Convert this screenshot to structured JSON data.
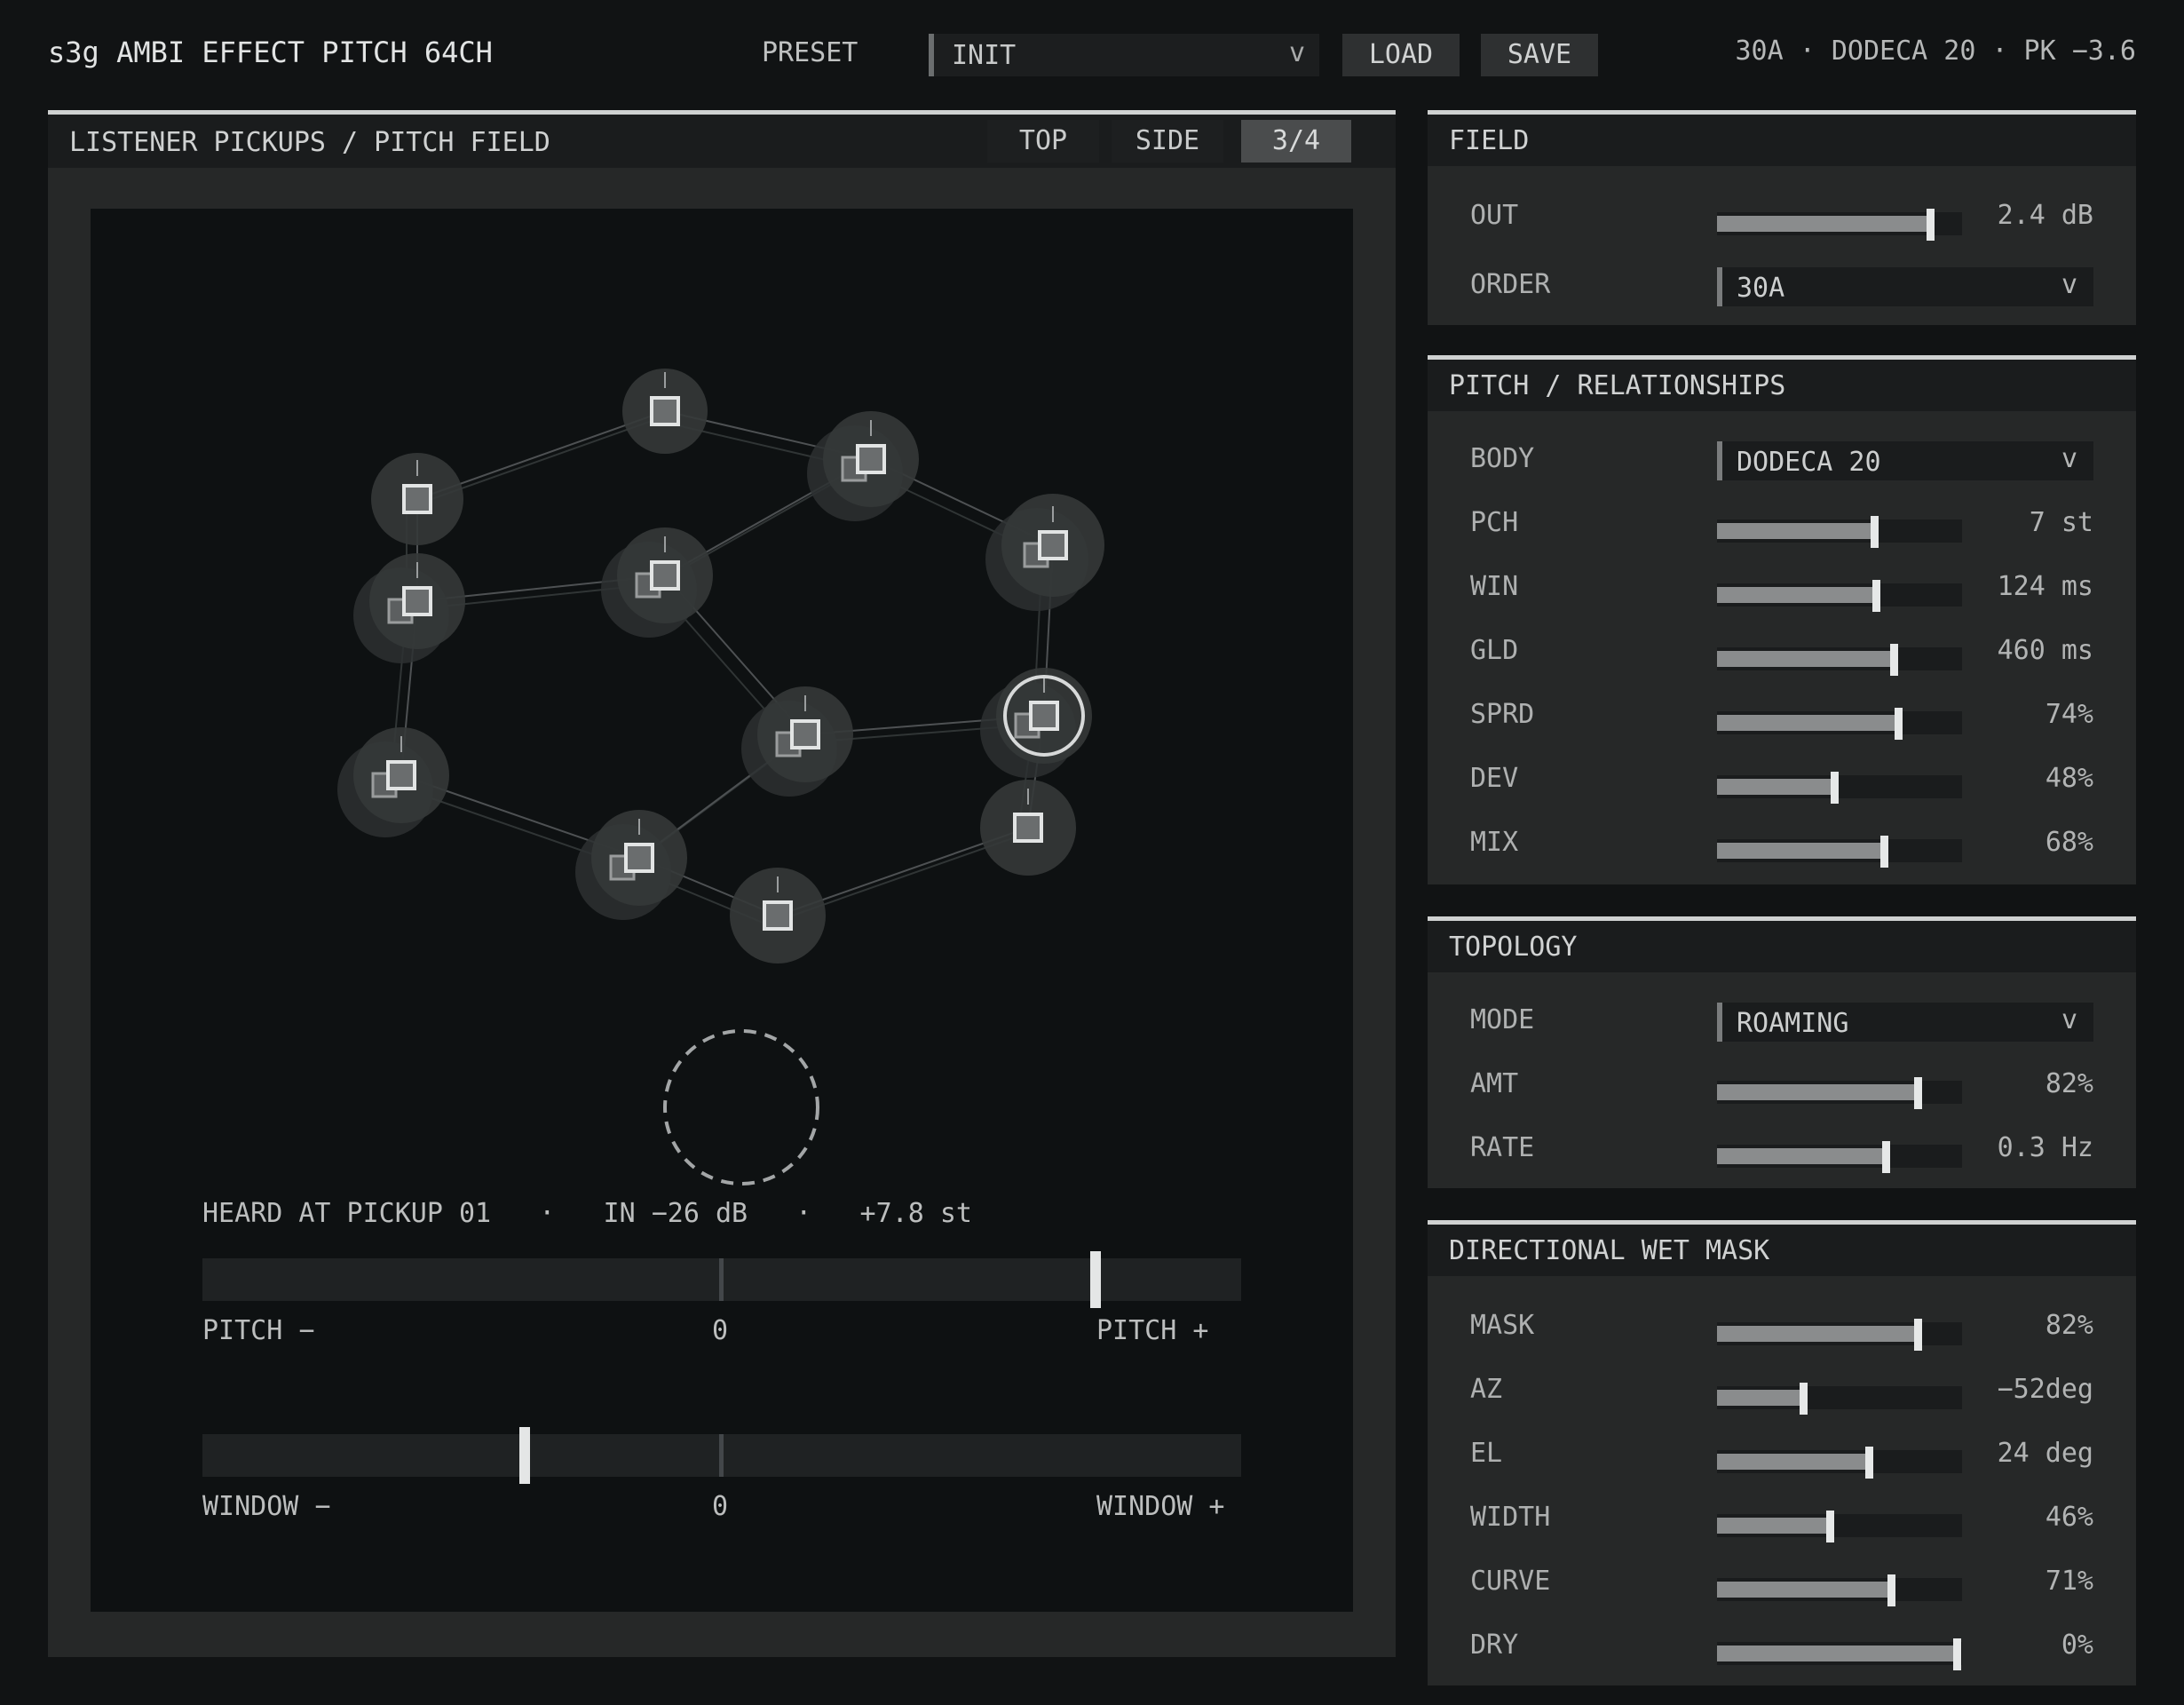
{
  "header": {
    "app_title": "s3g AMBI EFFECT PITCH 64CH",
    "preset_label": "PRESET",
    "preset_value": "INIT",
    "load_label": "LOAD",
    "save_label": "SAVE",
    "status_readout": "30A · DODECA 20 · PK −3.6",
    "chevron": "v"
  },
  "field_panel": {
    "title": "LISTENER PICKUPS / PITCH FIELD",
    "tabs": [
      {
        "label": "TOP",
        "active": false
      },
      {
        "label": "SIDE",
        "active": false
      },
      {
        "label": "3/4",
        "active": true
      }
    ],
    "heard_readout": "HEARD AT PICKUP 01   ·   IN −26 dB   ·   +7.8 st",
    "pitch_bar": {
      "minus_label": "PITCH −",
      "center_label": "0",
      "plus_label": "PITCH +",
      "value_fraction": 0.86
    },
    "window_bar": {
      "minus_label": "WINDOW −",
      "center_label": "0",
      "plus_label": "WINDOW +",
      "value_fraction": 0.31
    }
  },
  "panels": {
    "field": {
      "title": "FIELD",
      "rows": [
        {
          "label": "OUT",
          "kind": "slider",
          "fraction": 0.87,
          "value": "2.4 dB"
        },
        {
          "label": "ORDER",
          "kind": "select",
          "value": "30A"
        }
      ]
    },
    "pitch": {
      "title": "PITCH / RELATIONSHIPS",
      "rows": [
        {
          "label": "BODY",
          "kind": "select",
          "value": "DODECA 20"
        },
        {
          "label": "PCH",
          "kind": "slider",
          "fraction": 0.64,
          "value": "7 st"
        },
        {
          "label": "WIN",
          "kind": "slider",
          "fraction": 0.65,
          "value": "124 ms"
        },
        {
          "label": "GLD",
          "kind": "slider",
          "fraction": 0.72,
          "value": "460 ms"
        },
        {
          "label": "SPRD",
          "kind": "slider",
          "fraction": 0.74,
          "value": "74%"
        },
        {
          "label": "DEV",
          "kind": "slider",
          "fraction": 0.48,
          "value": "48%"
        },
        {
          "label": "MIX",
          "kind": "slider",
          "fraction": 0.68,
          "value": "68%"
        }
      ]
    },
    "topology": {
      "title": "TOPOLOGY",
      "rows": [
        {
          "label": "MODE",
          "kind": "select",
          "value": "ROAMING"
        },
        {
          "label": "AMT",
          "kind": "slider",
          "fraction": 0.82,
          "value": "82%"
        },
        {
          "label": "RATE",
          "kind": "slider",
          "fraction": 0.69,
          "value": "0.3 Hz"
        }
      ]
    },
    "mask": {
      "title": "DIRECTIONAL WET MASK",
      "rows": [
        {
          "label": "MASK",
          "kind": "slider",
          "fraction": 0.82,
          "value": "82%"
        },
        {
          "label": "AZ",
          "kind": "slider",
          "fraction": 0.35,
          "value": "−52deg"
        },
        {
          "label": "EL",
          "kind": "slider",
          "fraction": 0.62,
          "value": "24 deg"
        },
        {
          "label": "WIDTH",
          "kind": "slider",
          "fraction": 0.46,
          "value": "46%"
        },
        {
          "label": "CURVE",
          "kind": "slider",
          "fraction": 0.71,
          "value": "71%"
        },
        {
          "label": "DRY",
          "kind": "slider",
          "fraction": 0.98,
          "value": "0%"
        }
      ]
    }
  },
  "colors": {
    "background": "#111314",
    "panel": "#262828",
    "canvas": "#0e1112",
    "accent": "#e4e6e6"
  }
}
